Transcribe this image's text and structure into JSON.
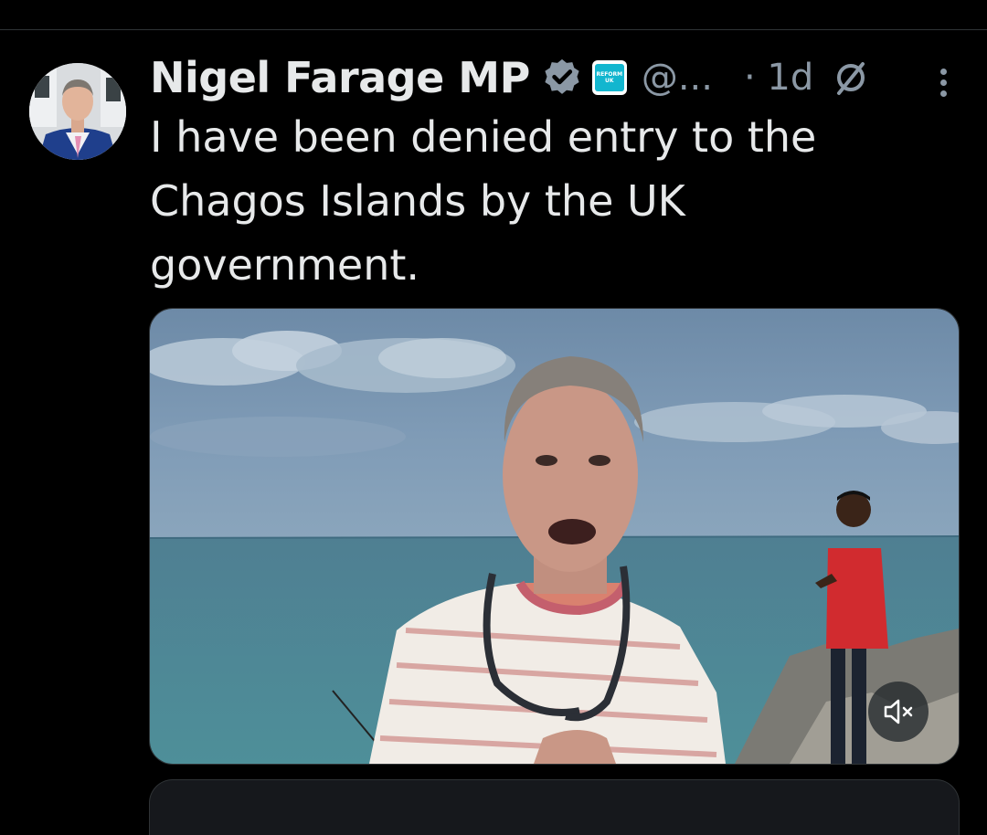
{
  "tweet": {
    "author_name": "Nigel Farage MP",
    "handle": "@...",
    "time": "· 1d",
    "text": "I have been denied entry to the\nChagos Islands by the UK\ngovernment.",
    "affiliation_badge": {
      "text_line1": "REFORM",
      "text_line2": "UK"
    }
  },
  "icons": {
    "verified": "verified-badge-icon",
    "affiliation": "reform-uk-badge-icon",
    "time_indicator": "slashed-circle-icon",
    "more": "more-options-icon",
    "mute": "volume-muted-icon"
  },
  "colors": {
    "background": "#000000",
    "text": "#e7e9ea",
    "secondary": "#8b98a5",
    "verified_badge": "#8b98a5",
    "affiliation": "#12b6cf"
  }
}
